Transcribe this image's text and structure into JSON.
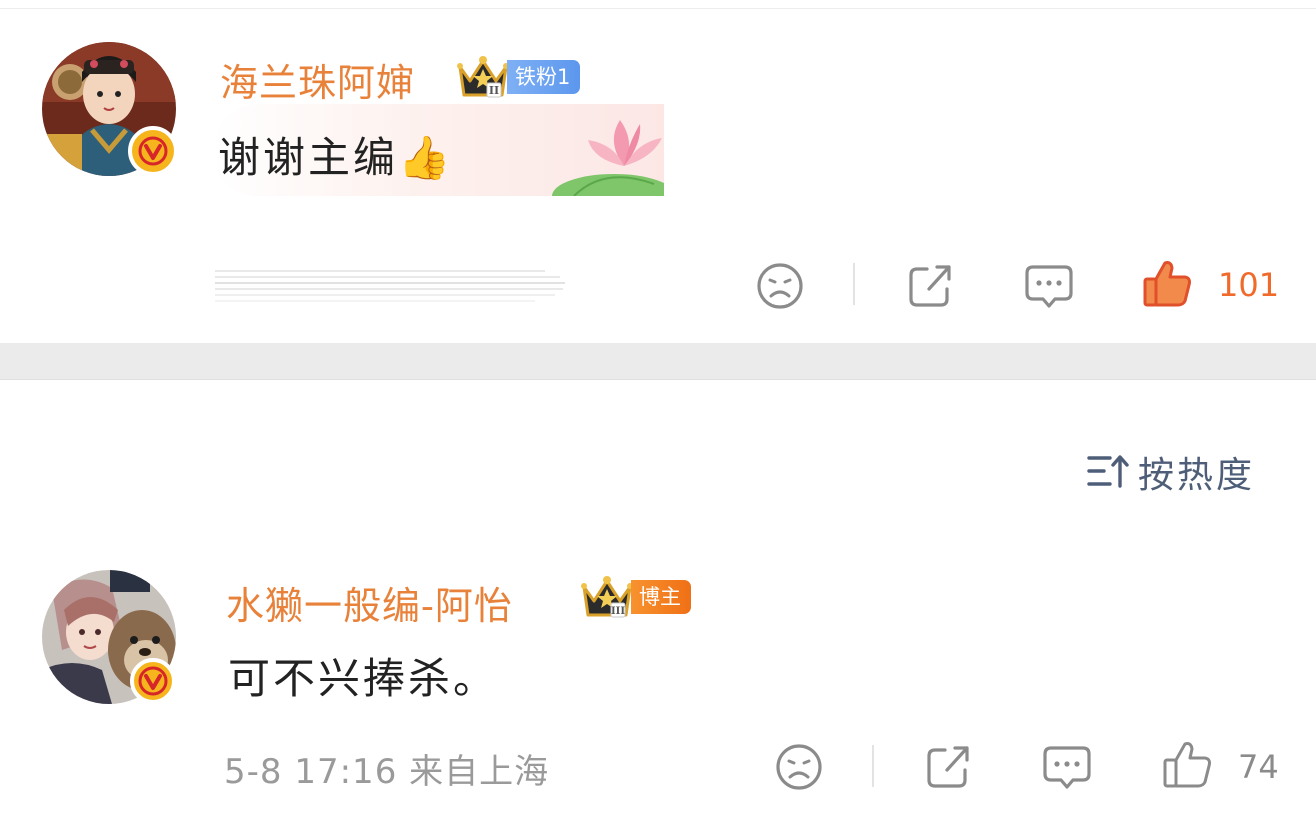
{
  "comment1": {
    "username": "海兰珠阿婶",
    "fan_badge": "铁粉1",
    "text": "谢谢主编👍",
    "like_count": "101",
    "colors": {
      "liked": "#f06a2c",
      "username": "#e8823a"
    }
  },
  "sort": {
    "label": "按热度"
  },
  "comment2": {
    "username": "水獭一般编-阿怡",
    "role_badge": "博主",
    "text": "可不兴捧杀。",
    "meta": "5-8 17:16  来自上海",
    "like_count": "74"
  },
  "icons": [
    "dislike-face-icon",
    "share-icon",
    "comment-icon",
    "thumbs-up-icon",
    "sort-icon",
    "verified-v-icon",
    "crown-icon"
  ]
}
